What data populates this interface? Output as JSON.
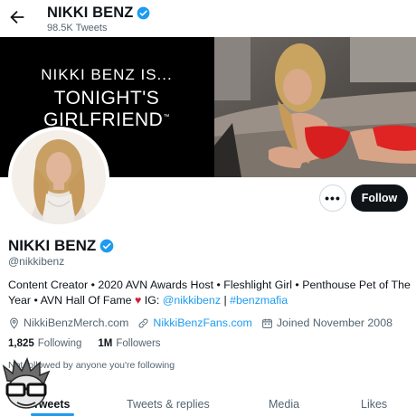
{
  "header": {
    "name": "NIKKI BENZ",
    "tweet_count": "98.5K Tweets"
  },
  "banner": {
    "line1": "NIKKI BENZ IS...",
    "line2": "TONIGHT'S GIRLFRIEND",
    "trademark": "™"
  },
  "actions": {
    "more": "•••",
    "follow": "Follow"
  },
  "profile": {
    "name": "NIKKI BENZ",
    "handle": "@nikkibenz",
    "bio_part1": "Content Creator • 2020 AVN Awards Host • Fleshlight Girl • Penthouse Pet of The Year •  AVN Hall Of Fame ",
    "bio_heart": "♥",
    "bio_part2": " IG: ",
    "bio_ig": "@nikkibenz",
    "bio_sep": " | ",
    "bio_hashtag": "#benzmafia",
    "location": "NikkiBenzMerch.com",
    "website": "NikkiBenzFans.com",
    "joined": "Joined November 2008",
    "following_count": "1,825",
    "following_label": "Following",
    "followers_count": "1M",
    "followers_label": "Followers",
    "not_followed": "Not followed by anyone you're following"
  },
  "tabs": [
    "Tweets",
    "Tweets & replies",
    "Media",
    "Likes"
  ],
  "colors": {
    "accent": "#1d9bf0",
    "text": "#0f1419",
    "muted": "#536471",
    "heart": "#cf1f3a"
  },
  "icons": [
    "back-arrow-icon",
    "verified-badge-icon",
    "location-icon",
    "link-icon",
    "calendar-icon",
    "more-icon"
  ]
}
